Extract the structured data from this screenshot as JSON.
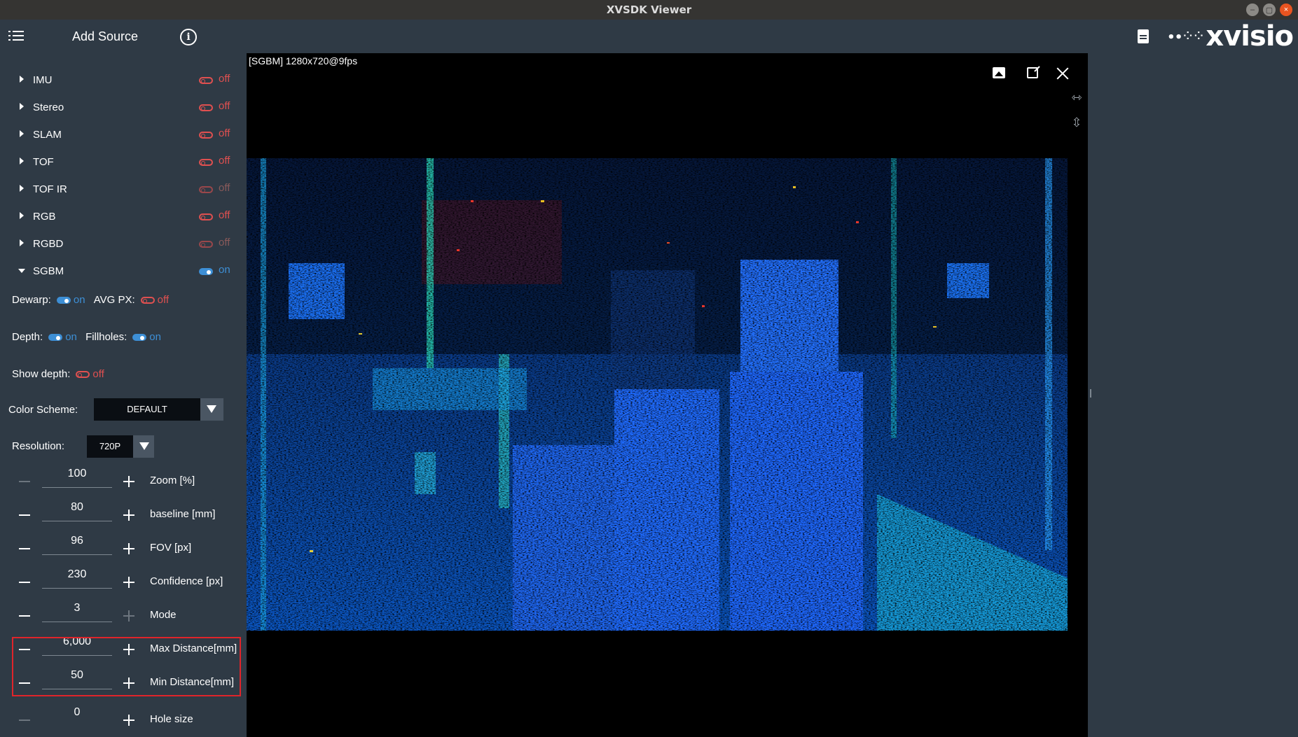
{
  "window": {
    "title": "XVSDK Viewer"
  },
  "header": {
    "add_source_label": "Add Source",
    "logo_text": "xvisio"
  },
  "streams": [
    {
      "label": "IMU",
      "state": "off",
      "expanded": false,
      "disabled": false
    },
    {
      "label": "Stereo",
      "state": "off",
      "expanded": false,
      "disabled": false
    },
    {
      "label": "SLAM",
      "state": "off",
      "expanded": false,
      "disabled": false
    },
    {
      "label": "TOF",
      "state": "off",
      "expanded": false,
      "disabled": false
    },
    {
      "label": "TOF IR",
      "state": "off",
      "expanded": false,
      "disabled": true
    },
    {
      "label": "RGB",
      "state": "off",
      "expanded": false,
      "disabled": false
    },
    {
      "label": "RGBD",
      "state": "off",
      "expanded": false,
      "disabled": true
    },
    {
      "label": "SGBM",
      "state": "on",
      "expanded": true,
      "disabled": false
    }
  ],
  "sgbm_options": {
    "dewarp": {
      "label": "Dewarp:",
      "state": "on"
    },
    "avg_px": {
      "label": "AVG PX:",
      "state": "off"
    },
    "depth": {
      "label": "Depth:",
      "state": "on"
    },
    "fillholes": {
      "label": "Fillholes:",
      "state": "on"
    },
    "show_depth": {
      "label": "Show depth:",
      "state": "off"
    },
    "color_scheme": {
      "label": "Color Scheme:",
      "value": "DEFAULT"
    },
    "resolution": {
      "label": "Resolution:",
      "value": "720P"
    }
  },
  "steppers": [
    {
      "label": "Zoom [%]",
      "value": "100",
      "minus_enabled": false,
      "plus_enabled": true
    },
    {
      "label": "baseline [mm]",
      "value": "80",
      "minus_enabled": true,
      "plus_enabled": true
    },
    {
      "label": "FOV [px]",
      "value": "96",
      "minus_enabled": true,
      "plus_enabled": true
    },
    {
      "label": "Confidence [px]",
      "value": "230",
      "minus_enabled": true,
      "plus_enabled": true
    },
    {
      "label": "Mode",
      "value": "3",
      "minus_enabled": true,
      "plus_enabled": false
    },
    {
      "label": "Max Distance[mm]",
      "value": "6,000",
      "minus_enabled": true,
      "plus_enabled": true
    },
    {
      "label": "Min Distance[mm]",
      "value": "50",
      "minus_enabled": true,
      "plus_enabled": true
    },
    {
      "label": "Hole size",
      "value": "0",
      "minus_enabled": false,
      "plus_enabled": true
    }
  ],
  "viewer": {
    "caption": "[SGBM]  1280x720@9fps"
  },
  "colors": {
    "toggle_on": "#3d8fd6",
    "toggle_off": "#e05050",
    "highlight": "#e0242a",
    "panel": "#2f3a45"
  }
}
